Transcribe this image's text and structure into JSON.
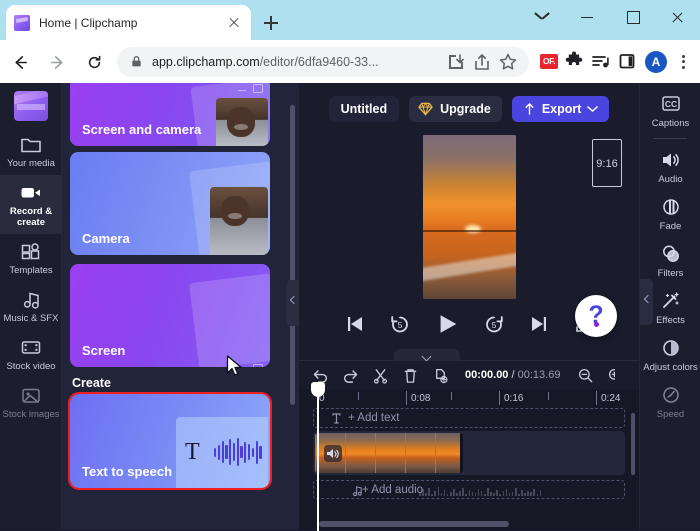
{
  "browser": {
    "tab": {
      "title": "Home | Clipchamp",
      "favicon": "clipchamp-favicon"
    },
    "new_tab_label": "+",
    "url_bold": "app.clipchamp.com",
    "url_rest": "/editor/6dfa9460-33...",
    "extension_badge": "OF.",
    "avatar_initial": "A",
    "nav": {
      "back": "Back",
      "forward": "Forward",
      "reload": "Reload"
    },
    "icons": [
      "install-icon",
      "share-icon",
      "bookmark-star-icon",
      "extensions-puzzle-icon",
      "media-controls-icon",
      "side-panel-icon",
      "profile-avatar",
      "chrome-menu-icon"
    ],
    "window_controls": [
      "tab-search-chevron",
      "minimize",
      "maximize",
      "close"
    ]
  },
  "left_rail": {
    "logo": "clipchamp-logo",
    "items": [
      {
        "label": "Your media",
        "icon": "folder-icon",
        "active": false
      },
      {
        "label": "Record & create",
        "icon": "video-camera-icon",
        "active": true
      },
      {
        "label": "Templates",
        "icon": "templates-icon",
        "active": false
      },
      {
        "label": "Music & SFX",
        "icon": "music-note-icon",
        "active": false
      },
      {
        "label": "Stock video",
        "icon": "film-strip-icon",
        "active": false
      },
      {
        "label": "Stock images",
        "icon": "image-icon",
        "active": false
      }
    ]
  },
  "panel": {
    "cards": [
      {
        "label": "Screen and camera",
        "kind": "screen-and-camera"
      },
      {
        "label": "Camera",
        "kind": "camera"
      },
      {
        "label": "Screen",
        "kind": "screen"
      }
    ],
    "section_title": "Create",
    "create_cards": [
      {
        "label": "Text to speech",
        "kind": "text-to-speech",
        "selected": true
      }
    ]
  },
  "stage": {
    "project_title": "Untitled",
    "upgrade_label": "Upgrade",
    "export_label": "Export",
    "aspect_ratio": "9:16",
    "help_label": "?",
    "transport": [
      {
        "name": "skip-to-start-button"
      },
      {
        "name": "rewind-5-button",
        "value": "5"
      },
      {
        "name": "play-button"
      },
      {
        "name": "forward-5-button",
        "value": "5"
      },
      {
        "name": "skip-to-end-button"
      },
      {
        "name": "fullscreen-button"
      }
    ]
  },
  "right_rail": {
    "items": [
      {
        "label": "Captions",
        "icon": "cc-icon"
      },
      {
        "label": "Audio",
        "icon": "speaker-icon"
      },
      {
        "label": "Fade",
        "icon": "fade-icon"
      },
      {
        "label": "Filters",
        "icon": "filters-icon"
      },
      {
        "label": "Effects",
        "icon": "magic-wand-icon"
      },
      {
        "label": "Adjust colors",
        "icon": "half-circle-icon"
      },
      {
        "label": "Speed",
        "icon": "speedometer-icon"
      }
    ]
  },
  "timeline": {
    "tools": [
      {
        "name": "undo-button",
        "icon": "undo-icon"
      },
      {
        "name": "redo-button",
        "icon": "redo-icon"
      },
      {
        "name": "split-button",
        "icon": "scissors-icon"
      },
      {
        "name": "delete-button",
        "icon": "trash-icon"
      },
      {
        "name": "duplicate-button",
        "icon": "duplicate-icon"
      }
    ],
    "current_time": "00:00.00",
    "separator": "/",
    "total_time": "00:13.69",
    "zoom_out": "zoom-out-icon",
    "zoom_in": "zoom-in-icon",
    "ruler_labels": [
      "0",
      "0:08",
      "0:16",
      "0:24"
    ],
    "add_text_label": "+ Add text",
    "add_audio_label": "+ Add audio",
    "clip": {
      "name": "sunset-beach-clip",
      "muted": true
    }
  }
}
